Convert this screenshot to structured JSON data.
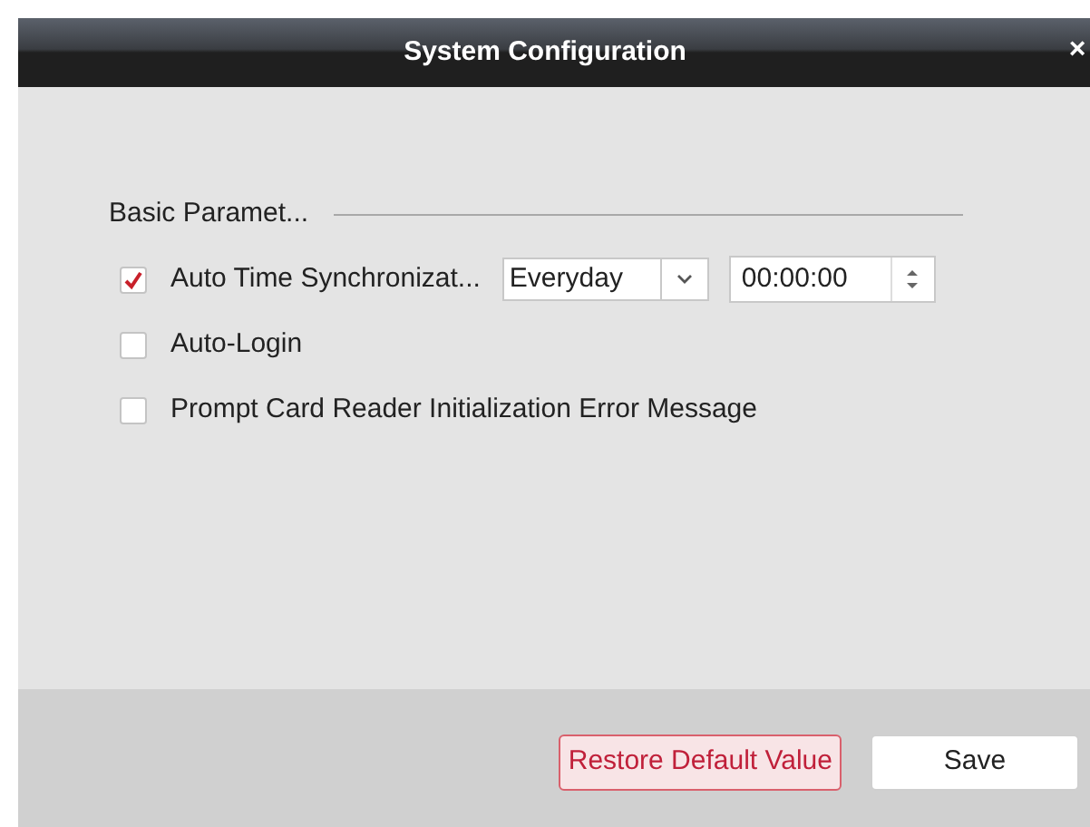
{
  "window": {
    "title": "System Configuration",
    "close": "×"
  },
  "section": {
    "title": "Basic Paramet..."
  },
  "options": [
    {
      "kind": "time_sync",
      "label": "Auto Time Synchronizat...",
      "checked": true,
      "frequency": "Everyday",
      "time": "00:00:00"
    },
    {
      "kind": "plain",
      "label": "Auto-Login",
      "checked": false
    },
    {
      "kind": "plain",
      "label": "Prompt Card Reader Initialization Error Message",
      "checked": false
    }
  ],
  "buttons": [
    {
      "label": "Restore Default Value",
      "kind": "danger"
    },
    {
      "label": "Save",
      "kind": "normal"
    }
  ]
}
